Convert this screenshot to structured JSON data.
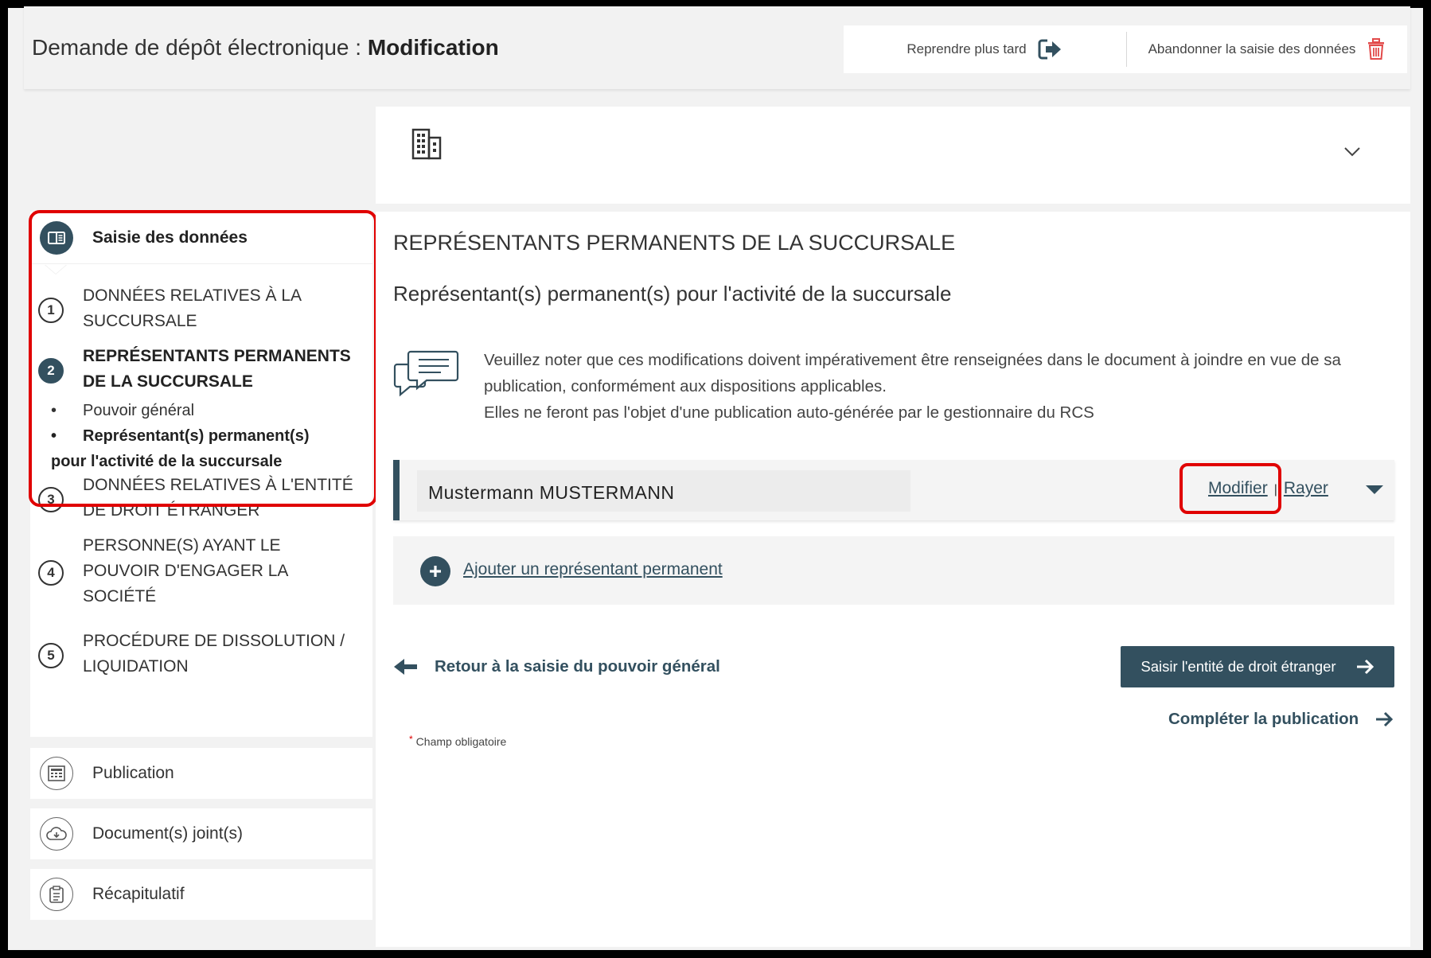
{
  "header": {
    "title_prefix": "Demande de dépôt électronique : ",
    "title_bold": "Modification",
    "resume_label": "Reprendre plus tard",
    "abandon_label": "Abandonner la saisie des données"
  },
  "sidebar": {
    "heading": "Saisie des données",
    "steps": [
      {
        "num": "1",
        "label_line1": "DONNÉES RELATIVES À LA",
        "label_line2": "SUCCURSALE"
      },
      {
        "num": "2",
        "label_line1": "REPRÉSENTANTS PERMANENTS",
        "label_line2": "DE LA SUCCURSALE"
      },
      {
        "num": "3",
        "label_line1": "DONNÉES RELATIVES À L'ENTITÉ",
        "label_line2": "DE DROIT ÉTRANGER"
      },
      {
        "num": "4",
        "label_line1": "PERSONNE(S) AYANT LE",
        "label_line2": "POUVOIR D'ENGAGER LA",
        "label_line3": "SOCIÉTÉ"
      },
      {
        "num": "5",
        "label_line1": "PROCÉDURE DE DISSOLUTION /",
        "label_line2": "LIQUIDATION"
      }
    ],
    "substeps": [
      {
        "bullet": "•",
        "label": "Pouvoir général"
      },
      {
        "bullet": "•",
        "label_line1": "Représentant(s) permanent(s)",
        "label_line2": "pour l'activité de la succursale"
      }
    ],
    "sections": [
      {
        "label": "Publication",
        "icon": "calculator-icon"
      },
      {
        "label": "Document(s) joint(s)",
        "icon": "cloud-upload-icon"
      },
      {
        "label": "Récapitulatif",
        "icon": "clipboard-icon"
      }
    ]
  },
  "main": {
    "title": "REPRÉSENTANTS PERMANENTS DE LA SUCCURSALE",
    "subtitle": "Représentant(s) permanent(s) pour l'activité de la succursale",
    "notice_line1": "Veuillez noter que ces modifications doivent impérativement être renseignées dans le document à joindre en vue de sa",
    "notice_line2": "publication, conformément aux dispositions applicables.",
    "notice_line3": "Elles ne feront pas l'objet d'une publication auto-générée par le gestionnaire du RCS",
    "representative_name": "Mustermann MUSTERMANN",
    "modify_label": "Modifier",
    "pipe": "|",
    "strike_label": "Rayer",
    "add_label": "Ajouter un représentant permanent",
    "back_label": "Retour à la saisie du pouvoir général",
    "next_label": "Saisir l'entité de droit étranger",
    "complete_label": "Compléter la publication",
    "required_star": "*",
    "required_note": "Champ obligatoire"
  },
  "colors": {
    "accent": "#33505f",
    "highlight": "#e00000",
    "trash": "#e24a4a"
  }
}
